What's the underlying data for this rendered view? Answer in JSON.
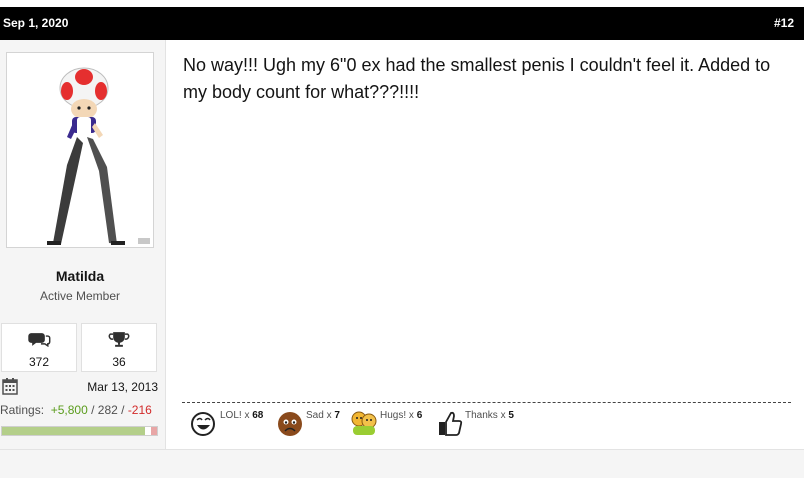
{
  "post": {
    "date": "Sep 1, 2020",
    "number": "#12",
    "message": "No way!!! Ugh my 6\"0 ex had the smallest penis I couldn't feel it. Added to my body count for what???!!!!"
  },
  "user": {
    "name": "Matilda",
    "title": "Active Member",
    "messages_count": "372",
    "trophy_points": "36",
    "joined": "Mar 13, 2013",
    "ratings_label": "Ratings:",
    "ratings_positive": "+5,800",
    "ratings_sep1": " / ",
    "ratings_neutral": "282",
    "ratings_sep2": " / ",
    "ratings_negative": "-216",
    "rating_share_positive": 0.92,
    "rating_share_negative": 0.04
  },
  "icons": {
    "messages": "speech-bubbles-icon",
    "trophy": "trophy-icon",
    "joined": "calendar-icon"
  },
  "reactions": [
    {
      "icon": "lol-face-icon",
      "label": "LOL! x",
      "count": "68"
    },
    {
      "icon": "sad-face-icon",
      "label": "Sad x",
      "count": "7"
    },
    {
      "icon": "hugs-icon",
      "label": "Hugs! x",
      "count": "6"
    },
    {
      "icon": "thumbs-up-icon",
      "label": "Thanks x",
      "count": "5"
    }
  ],
  "colors": {
    "header_bg": "#000000",
    "positive": "#5a9c1c",
    "negative": "#d22a2a",
    "sidebar_bg": "#f5f5f5"
  }
}
